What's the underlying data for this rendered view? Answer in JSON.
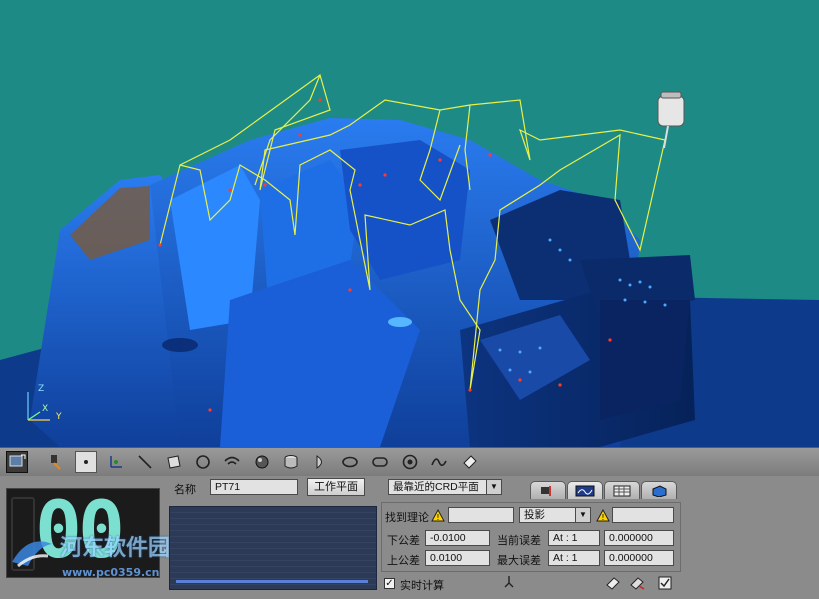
{
  "colors": {
    "viewport_bg": "#1e8a86",
    "part_blue": "#1a5fd8",
    "path_yellow": "#e8f04a",
    "led_digit": "#7be0cf",
    "panel_bg": "#8b8b8b"
  },
  "toolbar": {
    "items": [
      "cursor-mode-icon",
      "probe-pick-icon",
      "point-icon",
      "vector-point-icon",
      "line-icon",
      "plane-icon",
      "circle-icon",
      "arc-icon",
      "sphere-icon",
      "cylinder-icon",
      "cone-icon",
      "ellipse-icon",
      "slot-icon",
      "ring-icon",
      "curve-icon",
      "surface-icon"
    ]
  },
  "led": {
    "value": "00"
  },
  "watermark": {
    "text": "河东软件园",
    "url": "www.pc0359.cn"
  },
  "form": {
    "name_label": "名称",
    "name_value": "PT71",
    "workplane_button": "工作平面",
    "plane_select": "最靠近的CRD平面",
    "find_nominal_label": "找到理论",
    "projection_select": "投影",
    "lower_tol_label": "下公差",
    "lower_tol_value": "-0.0100",
    "upper_tol_label": "上公差",
    "upper_tol_value": "0.0100",
    "current_err_label": "当前误差",
    "current_err_at": "At : 1",
    "current_err_value": "0.000000",
    "max_err_label": "最大误差",
    "max_err_at": "At : 1",
    "max_err_value": "0.000000",
    "realtime_label": "实时计算",
    "realtime_checked": true
  },
  "tabs": [
    "probe-settings-tab",
    "path-tab",
    "table-tab",
    "box-tab"
  ],
  "axes": {
    "x": "X",
    "y": "Y",
    "z": "Z"
  }
}
